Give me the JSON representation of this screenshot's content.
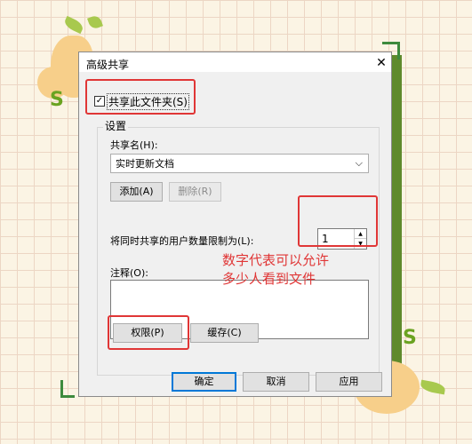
{
  "dialog": {
    "title": "高级共享",
    "share_checkbox_label": "共享此文件夹(S)",
    "share_checked": true,
    "settings_label": "设置",
    "share_name_label": "共享名(H):",
    "share_name_value": "实时更新文档",
    "add_button": "添加(A)",
    "remove_button": "删除(R)",
    "user_limit_label": "将同时共享的用户数量限制为(L):",
    "user_limit_value": "1",
    "comment_label": "注释(O):",
    "comment_value": "",
    "permissions_button": "权限(P)",
    "caching_button": "缓存(C)",
    "ok_button": "确定",
    "cancel_button": "取消",
    "apply_button": "应用"
  },
  "annotation": {
    "line1": "数字代表可以允许",
    "line2": "多少人看到文件",
    "color": "#e03636"
  },
  "icons": {
    "close": "close-icon",
    "checkmark": "checkmark-icon",
    "dropdown": "chevron-down-icon",
    "spin_up": "spin-up-icon",
    "spin_down": "spin-down-icon"
  },
  "colors": {
    "accent": "#0078d7",
    "annotation_red": "#e03636",
    "background": "#fbf4e4"
  }
}
